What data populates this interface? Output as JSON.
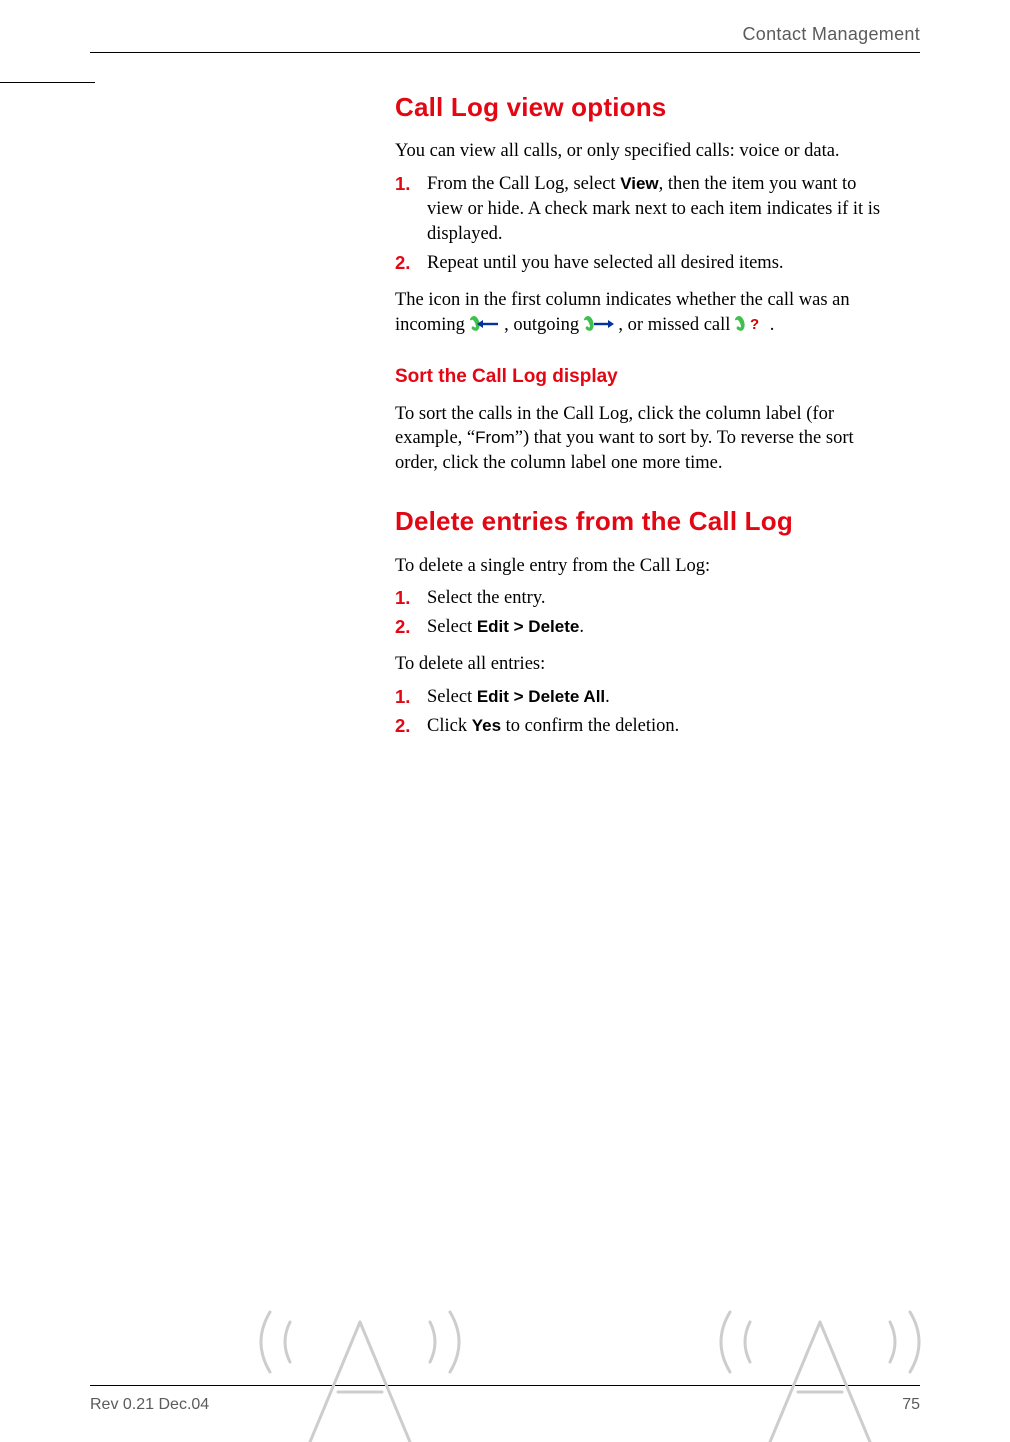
{
  "header": {
    "section": "Contact Management"
  },
  "footer": {
    "rev": "Rev 0.21  Dec.04",
    "page": "75"
  },
  "section1": {
    "title": "Call Log view options",
    "intro": "You can view all calls, or only specified calls: voice or data.",
    "step1": {
      "num": "1.",
      "a": "From the Call Log, select ",
      "view": "View",
      "b": ", then the item you want to view or hide. A check mark next to each item indicates if it is displayed."
    },
    "step2": {
      "num": "2.",
      "text": "Repeat until you have selected all desired items."
    },
    "iconline": {
      "a": "The icon in the first column indicates whether the call was an incoming ",
      "b": ", outgoing ",
      "c": ", or missed call ",
      "d": "."
    }
  },
  "section2": {
    "title": "Sort the Call Log display",
    "p1a": "To sort the calls in the Call Log, click the column label (for example, “",
    "p1from": "From",
    "p1b": "”) that you want to sort by. To reverse the sort order, click the column label one more time."
  },
  "section3": {
    "title": "Delete entries from the Call Log",
    "intro": "To delete a single entry from the Call Log:",
    "s1": {
      "num": "1.",
      "text": "Select the entry."
    },
    "s2": {
      "num": "2.",
      "a": "Select ",
      "cmd": "Edit > Delete",
      "b": "."
    },
    "intro2": "To delete all entries:",
    "s3": {
      "num": "1.",
      "a": "Select ",
      "cmd": "Edit > Delete All",
      "b": "."
    },
    "s4": {
      "num": "2.",
      "a": "Click ",
      "yes": "Yes",
      "b": " to confirm the deletion."
    }
  }
}
